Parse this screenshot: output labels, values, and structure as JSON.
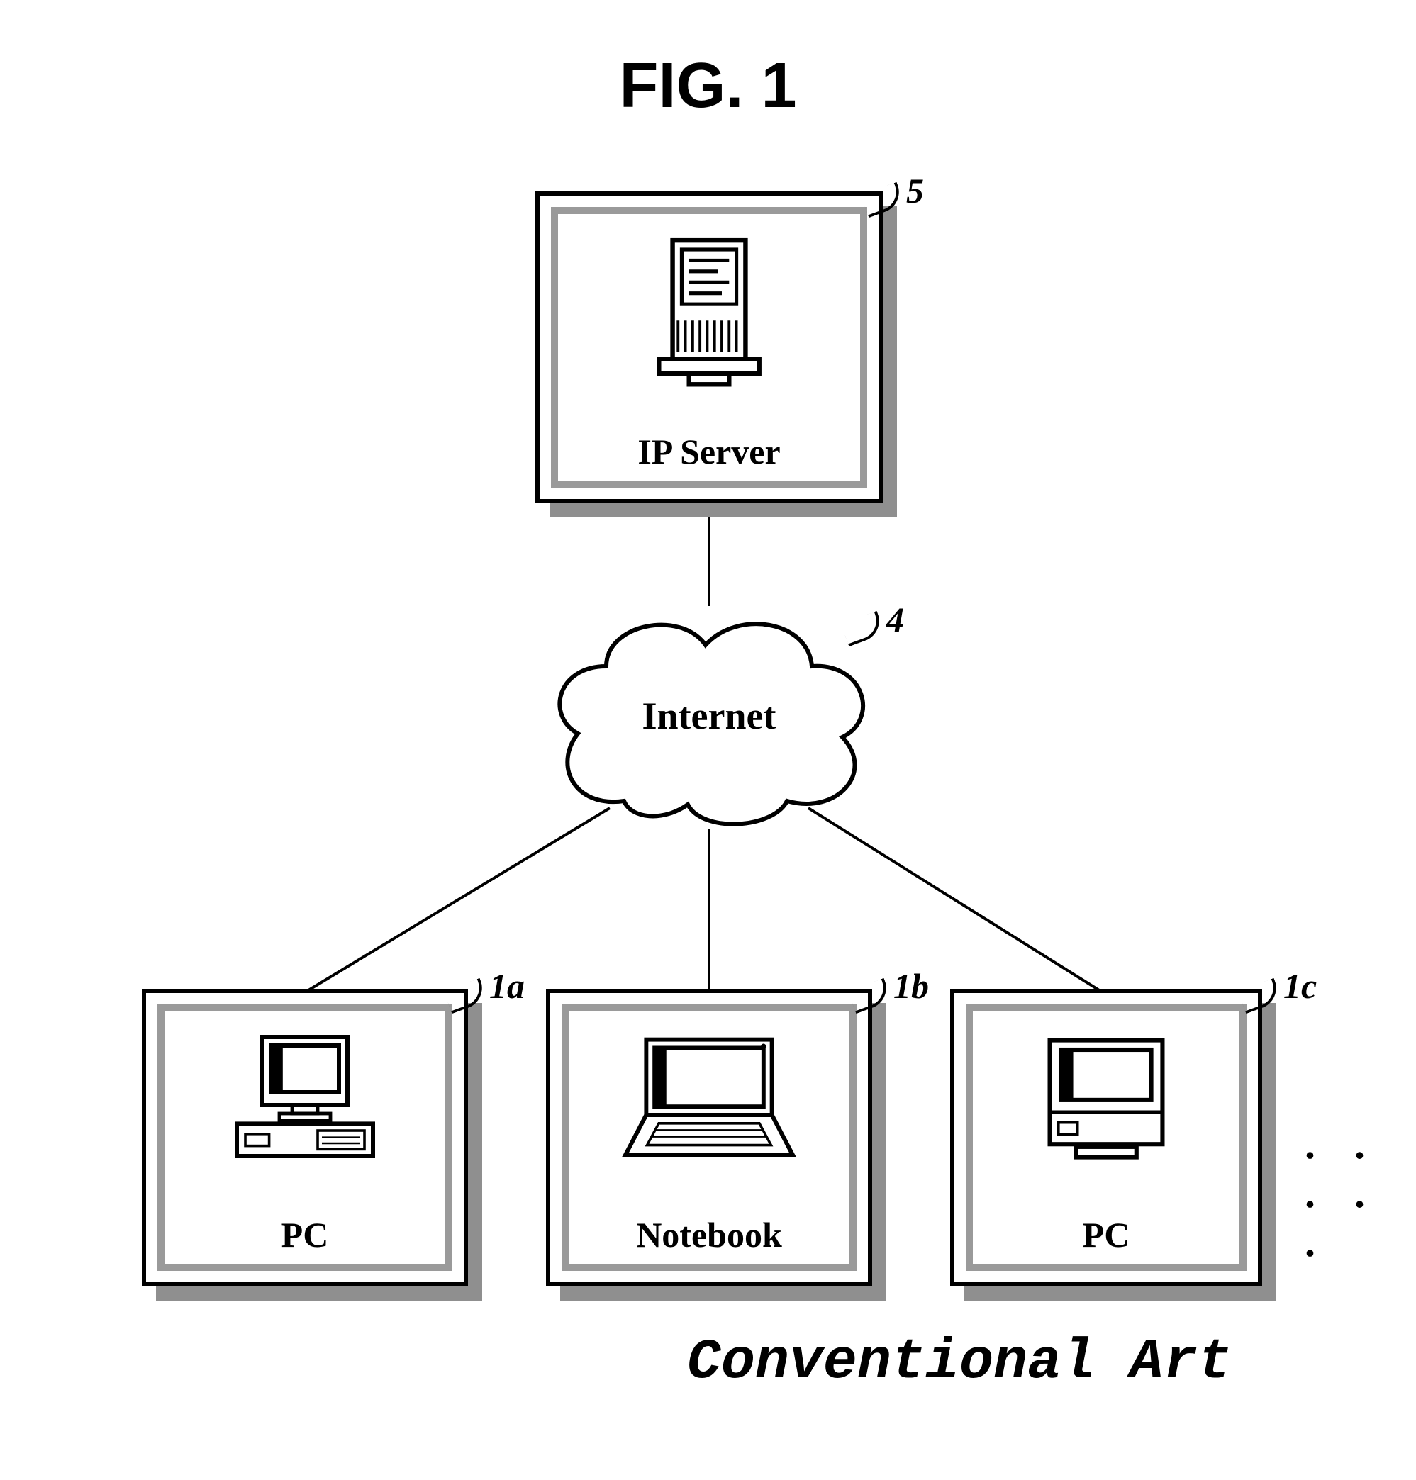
{
  "figure": {
    "title": "FIG. 1",
    "caption": "Conventional Art"
  },
  "nodes": {
    "server": {
      "label": "IP Server",
      "ref": "5"
    },
    "cloud": {
      "label": "Internet",
      "ref": "4"
    },
    "client_a": {
      "label": "PC",
      "ref": "1a"
    },
    "client_b": {
      "label": "Notebook",
      "ref": "1b"
    },
    "client_c": {
      "label": "PC",
      "ref": "1c"
    }
  },
  "ellipsis": ". . . . ."
}
